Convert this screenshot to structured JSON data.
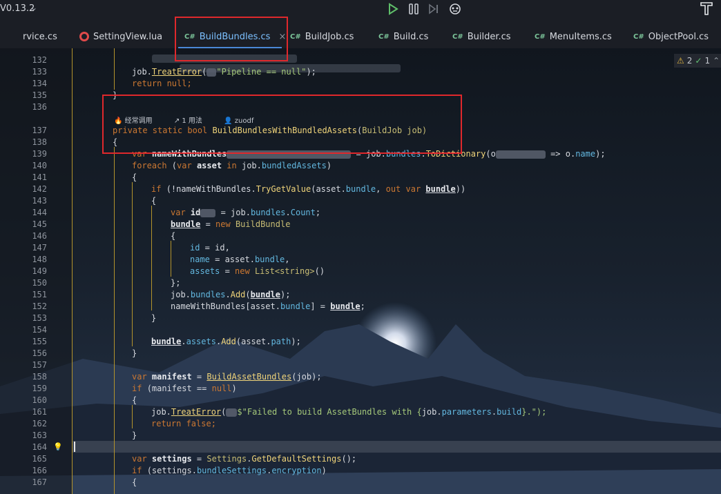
{
  "titlebar": {
    "version": "V0.13.2",
    "run_icon": "play-icon",
    "pause_icon": "pause-icon",
    "step_icon": "step-icon",
    "debug_icon": "debug-icon",
    "tool_icon": "hammer-icon"
  },
  "tabs": [
    {
      "label": "rvice.cs",
      "lang": ""
    },
    {
      "label": "SettingView.lua",
      "lang": "lua"
    },
    {
      "label": "BuildBundles.cs",
      "lang": "C#",
      "active": true
    },
    {
      "label": "BuildJob.cs",
      "lang": "C#"
    },
    {
      "label": "Build.cs",
      "lang": "C#"
    },
    {
      "label": "Builder.cs",
      "lang": "C#"
    },
    {
      "label": "MenuItems.cs",
      "lang": "C#"
    },
    {
      "label": "ObjectPool.cs",
      "lang": "C#"
    }
  ],
  "inspections": {
    "warnings": "2",
    "ok": "1"
  },
  "hints": {
    "usage": "经常调用",
    "refs": "1 用法",
    "author": "zuodf"
  },
  "line_numbers": [
    "132",
    "133",
    "134",
    "135",
    "136",
    "137",
    "138",
    "139",
    "140",
    "141",
    "142",
    "143",
    "144",
    "145",
    "146",
    "147",
    "148",
    "149",
    "150",
    "151",
    "152",
    "153",
    "154",
    "155",
    "156",
    "157",
    "158",
    "159",
    "160",
    "161",
    "162",
    "163",
    "164",
    "165",
    "166",
    "167"
  ],
  "code": {
    "l133_a": "job.",
    "l133_fn": "TreatError",
    "l133_str": "\"Pipeline == null\"",
    "l133_end": ");",
    "l134": "return null;",
    "l135": "}",
    "l137_mod": "private static bool ",
    "l137_fn": "BuildBundlesWithBundledAssets",
    "l137_p": "(",
    "l137_t": "BuildJob",
    "l137_arg": " job)",
    "l138": "{",
    "l139_var": "var ",
    "l139_name": "nameWithBundles",
    "l139_eq": " = ",
    "l139_job": "job.",
    "l139_b": "bundles",
    "l139_dot": ".",
    "l139_fn": "ToDictionary",
    "l139_o": "(o",
    "l139_arrow": " => o.",
    "l139_name2": "name",
    "l139_end": ");",
    "l140_fe": "foreach ",
    "l140_p": "(",
    "l140_var": "var ",
    "l140_asset": "asset ",
    "l140_in": "in ",
    "l140_job": "job.",
    "l140_ba": "bundledAssets",
    "l140_end": ")",
    "l141": "{",
    "l142_if": "if ",
    "l142_a": "(!nameWithBundles.",
    "l142_fn": "TryGetValue",
    "l142_b": "(asset.",
    "l142_bundle": "bundle",
    "l142_c": ", ",
    "l142_out": "out var ",
    "l142_d": "bundle",
    "l142_e": "))",
    "l143": "{",
    "l144_var": "var ",
    "l144_id": "id",
    "l144_eq": " = job.",
    "l144_b": "bundles",
    "l144_dot": ".",
    "l144_c": "Count",
    "l144_end": ";",
    "l145_b": "bundle",
    "l145_eq": " = ",
    "l145_new": "new ",
    "l145_t": "BuildBundle",
    "l146": "{",
    "l147_f": "id",
    "l147_r": " = id,",
    "l148_f": "name",
    "l148_r": " = asset.",
    "l148_b": "bundle",
    "l148_c": ",",
    "l149_f": "assets",
    "l149_eq": " = ",
    "l149_new": "new ",
    "l149_t": "List<string>",
    "l149_end": "()",
    "l150": "};",
    "l151_job": "job.",
    "l151_b": "bundles",
    "l151_dot": ".",
    "l151_fn": "Add",
    "l151_p": "(",
    "l151_v": "bundle",
    "l151_end": ");",
    "l152_a": "nameWithBundles[asset.",
    "l152_b": "bundle",
    "l152_c": "] = ",
    "l152_v": "bundle",
    "l152_end": ";",
    "l153": "}",
    "l155_v": "bundle",
    "l155_dot": ".",
    "l155_a": "assets",
    "l155_dot2": ".",
    "l155_fn": "Add",
    "l155_p": "(asset.",
    "l155_path": "path",
    "l155_end": ");",
    "l156": "}",
    "l158_var": "var ",
    "l158_m": "manifest",
    "l158_eq": " = ",
    "l158_fn": "BuildAssetBundles",
    "l158_end": "(job);",
    "l159_if": "if ",
    "l159_a": "(manifest == ",
    "l159_null": "null",
    "l159_end": ")",
    "l160": "{",
    "l161_job": "job.",
    "l161_fn": "TreatError",
    "l161_p": "(",
    "l161_s": "$\"Failed to build AssetBundles with {",
    "l161_j": "job.",
    "l161_pp": "parameters",
    "l161_d": ".",
    "l161_b": "build",
    "l161_end": "}.\");",
    "l162": "return false;",
    "l163": "}",
    "l165_var": "var ",
    "l165_s": "settings",
    "l165_eq": " = ",
    "l165_t": "Settings",
    "l165_dot": ".",
    "l165_fn": "GetDefaultSettings",
    "l165_end": "();",
    "l166_if": "if ",
    "l166_a": "(settings.",
    "l166_bs": "bundleSettings",
    "l166_dot": ".",
    "l166_enc": "encryption",
    "l166_end": ")",
    "l167": "{"
  }
}
